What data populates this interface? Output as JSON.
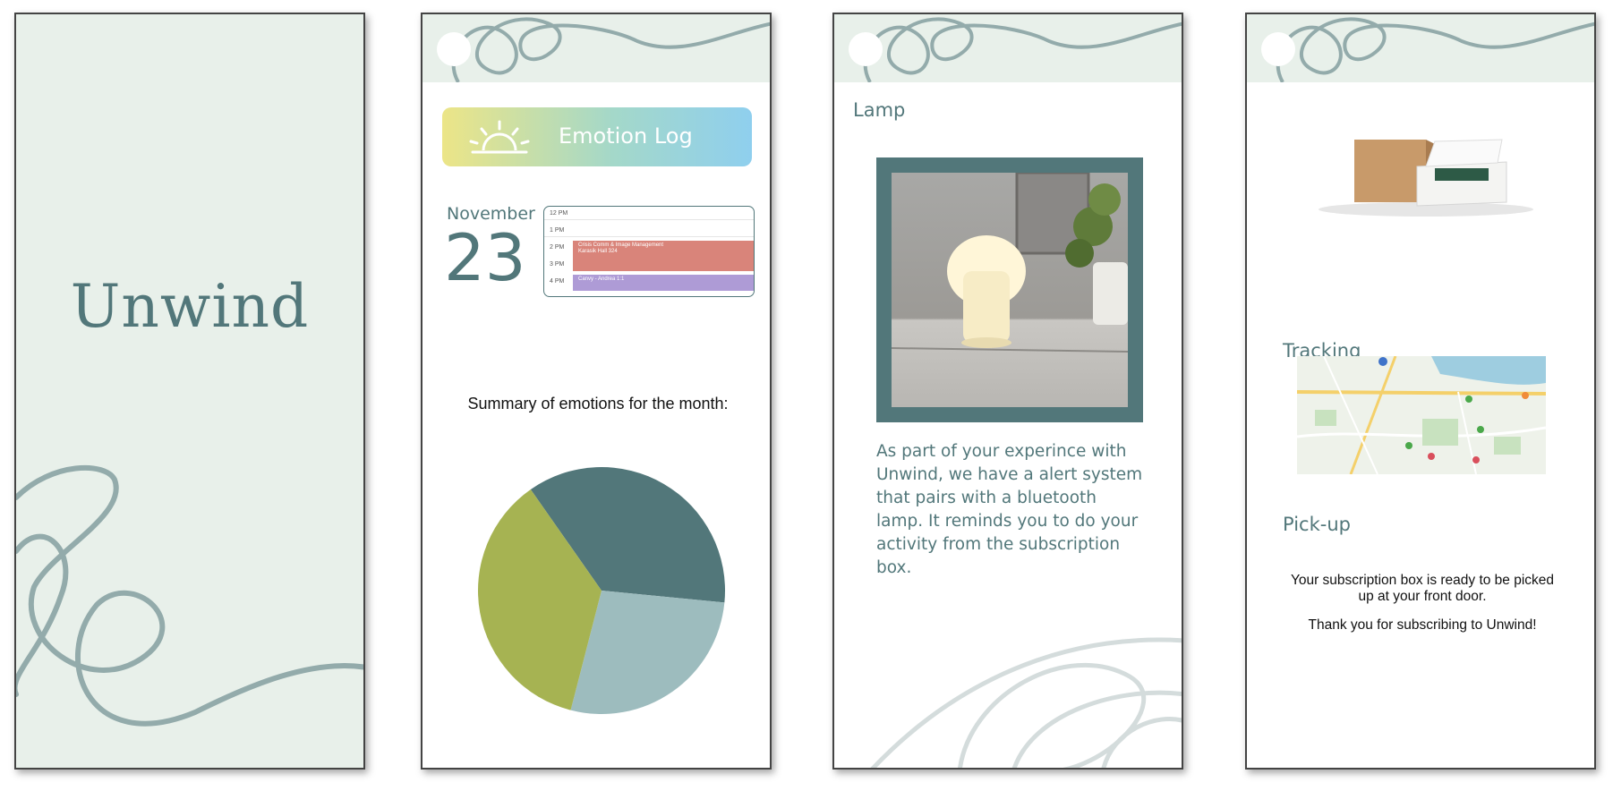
{
  "screen1": {
    "app_name": "Unwind"
  },
  "screen2": {
    "banner_title": "Emotion Log",
    "month": "November",
    "day": "23",
    "calendar": {
      "times": [
        "12 PM",
        "1 PM",
        "2 PM",
        "3 PM",
        "4 PM"
      ],
      "events": [
        {
          "title": "Crisis Comm & Image Management",
          "subtitle": "Karasik Hall 324"
        },
        {
          "title": "Canvy - Andrea 1:1"
        }
      ]
    },
    "summary_title": "Summary of emotions for the month:",
    "chart_data": {
      "type": "pie",
      "values": [
        33,
        25,
        33
      ],
      "colors": [
        "#52777a",
        "#9dbcbe",
        "#a6b352"
      ]
    }
  },
  "screen3": {
    "title": "Lamp",
    "description": "As part of your experince with Unwind, we have a alert system that pairs with a bluetooth lamp. It reminds you to do your activity from the subscription box."
  },
  "screen4": {
    "tracking_title": "Tracking",
    "pickup_title": "Pick-up",
    "pickup_message": "Your subscription box is ready to be picked up at your front door.",
    "thanks_message": "Thank you for subscribing to Unwind!"
  },
  "colors": {
    "teal": "#52777a",
    "mint_bg": "#e8f0ea",
    "swirl": "#93abab",
    "sage": "#a6b352",
    "light_teal": "#9dbcbe"
  }
}
